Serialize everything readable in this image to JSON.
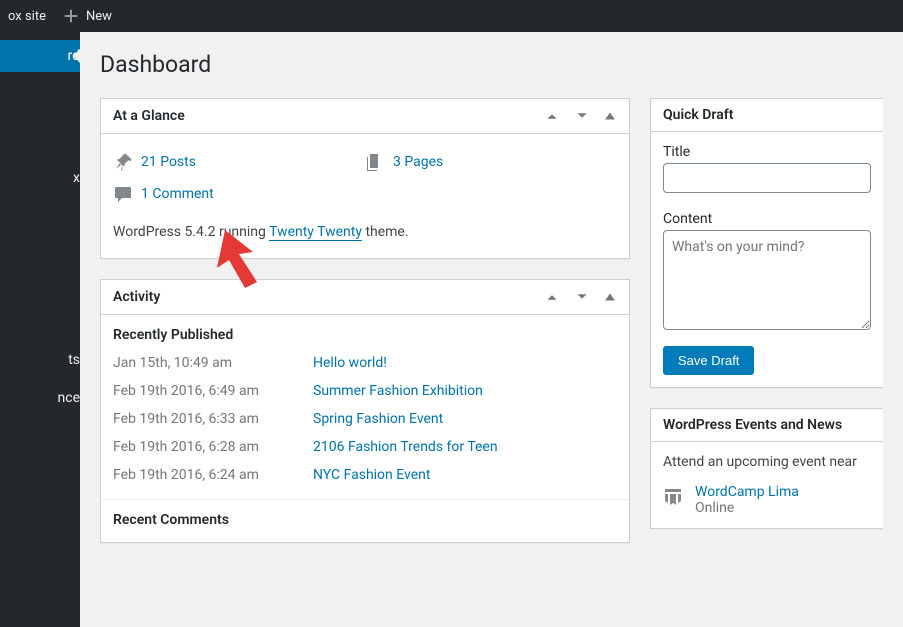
{
  "admin_bar": {
    "site_label": "ox site",
    "new_label": "New"
  },
  "sidebar": {
    "items": [
      "rd",
      "",
      "x",
      "",
      "",
      "ts",
      "",
      "nce"
    ]
  },
  "page_title": "Dashboard",
  "glance": {
    "title": "At a Glance",
    "posts": "21 Posts",
    "pages": "3 Pages",
    "comments": "1 Comment",
    "version_pre": "WordPress 5.4.2 running ",
    "theme_link": "Twenty Twenty",
    "version_post": " theme."
  },
  "activity": {
    "title": "Activity",
    "recent_published": "Recently Published",
    "recent_comments": "Recent Comments",
    "items": [
      {
        "date": "Jan 15th, 10:49 am",
        "title": "Hello world!"
      },
      {
        "date": "Feb 19th 2016, 6:49 am",
        "title": "Summer Fashion Exhibition"
      },
      {
        "date": "Feb 19th 2016, 6:33 am",
        "title": "Spring Fashion Event"
      },
      {
        "date": "Feb 19th 2016, 6:28 am",
        "title": "2106 Fashion Trends for Teen"
      },
      {
        "date": "Feb 19th 2016, 6:24 am",
        "title": "NYC Fashion Event"
      }
    ]
  },
  "quick_draft": {
    "title": "Quick Draft",
    "title_label": "Title",
    "content_label": "Content",
    "content_placeholder": "What's on your mind?",
    "save_label": "Save Draft"
  },
  "events": {
    "title": "WordPress Events and News",
    "intro": "Attend an upcoming event near",
    "item_title": "WordCamp Lima",
    "item_sub": "Online"
  }
}
